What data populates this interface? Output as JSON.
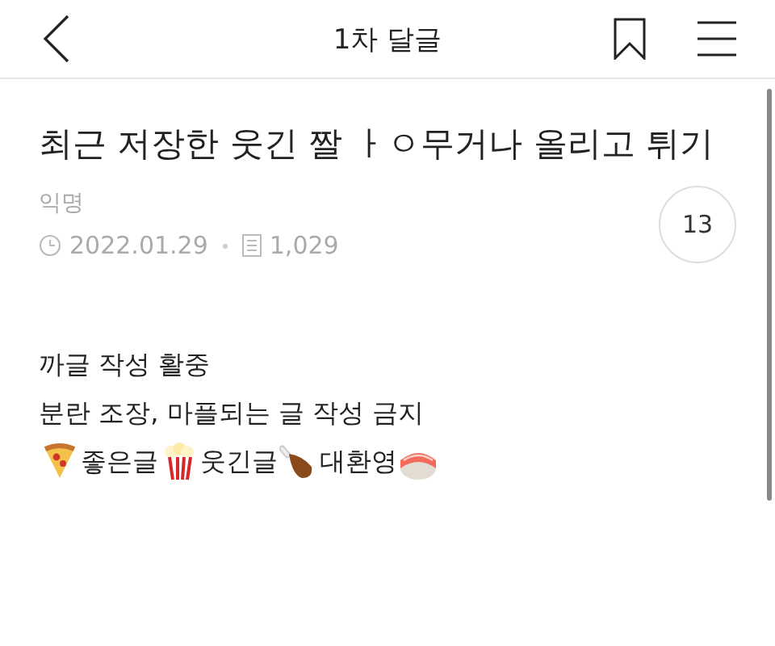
{
  "header": {
    "title": "1차 달글"
  },
  "post": {
    "title": "최근 저장한 웃긴 짤 ㅏㅇ무거나 올리고 튀기",
    "author": "익명",
    "date": "2022.01.29",
    "views": "1,029",
    "comment_count": "13"
  },
  "body": {
    "lines": [
      "까글 작성 활중",
      "분란 조장, 마플되는 글 작성 금지"
    ],
    "tags": [
      "좋은글",
      "웃긴글",
      "대환영"
    ]
  }
}
